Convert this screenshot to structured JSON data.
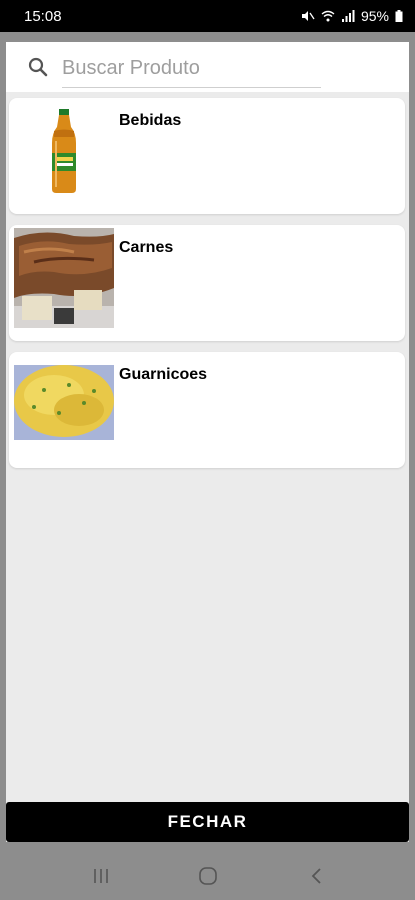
{
  "status_bar": {
    "time": "15:08",
    "battery": "95%"
  },
  "search": {
    "placeholder": "Buscar Produto"
  },
  "categories": [
    {
      "label": "Bebidas",
      "image": "soda-bottle-image"
    },
    {
      "label": "Carnes",
      "image": "meat-image"
    },
    {
      "label": "Guarnicoes",
      "image": "farofa-image"
    }
  ],
  "footer": {
    "close_label": "FECHAR"
  },
  "colors": {
    "dialog_background": "#ebebeb",
    "button_background": "#000000",
    "overlay": "#8d8d8d"
  }
}
